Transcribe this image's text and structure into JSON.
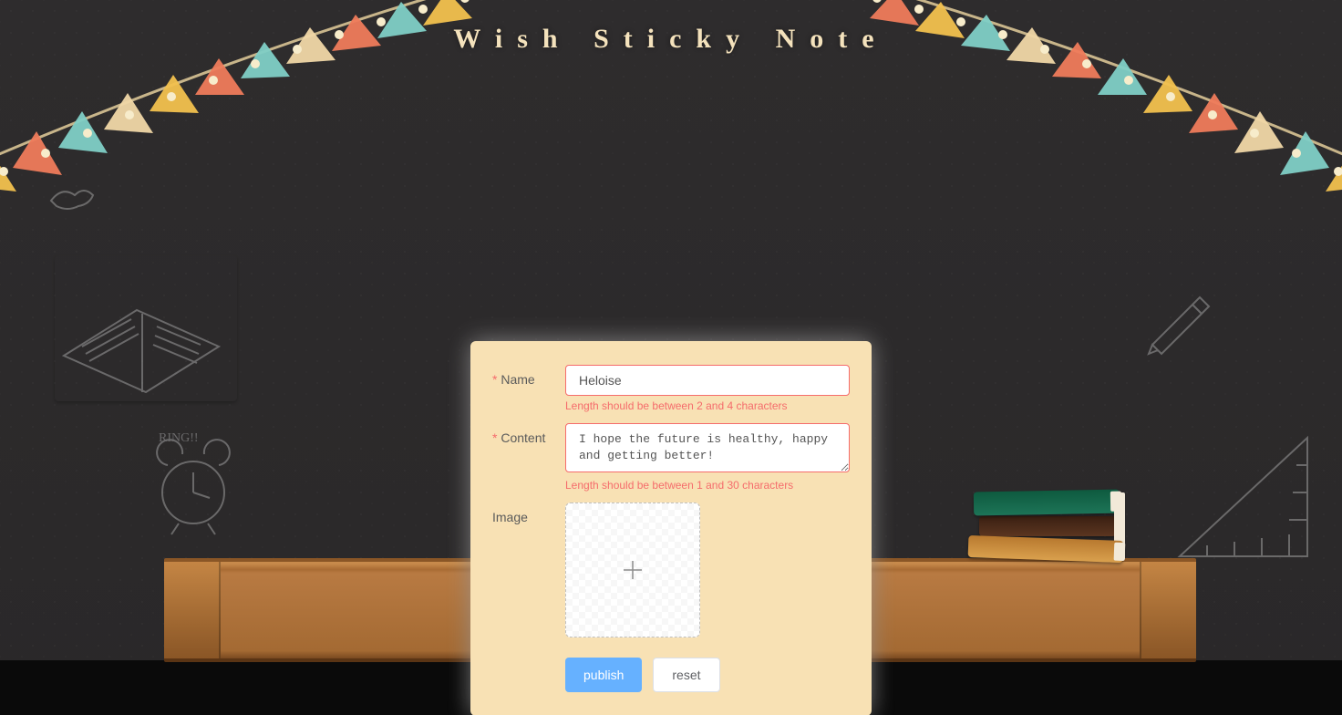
{
  "title": "Wish Sticky Note",
  "form": {
    "name": {
      "label": "Name",
      "value": "Heloise",
      "required": true,
      "error": "Length should be between 2 and 4 characters"
    },
    "content": {
      "label": "Content",
      "value": "I hope the future is healthy, happy and getting better!",
      "required": true,
      "error": "Length should be between 1 and 30 characters"
    },
    "image": {
      "label": "Image"
    },
    "actions": {
      "publish": "publish",
      "reset": "reset"
    }
  },
  "colors": {
    "accent": "#66b1ff",
    "error": "#f56c6c",
    "card": "#f8e1b4"
  }
}
